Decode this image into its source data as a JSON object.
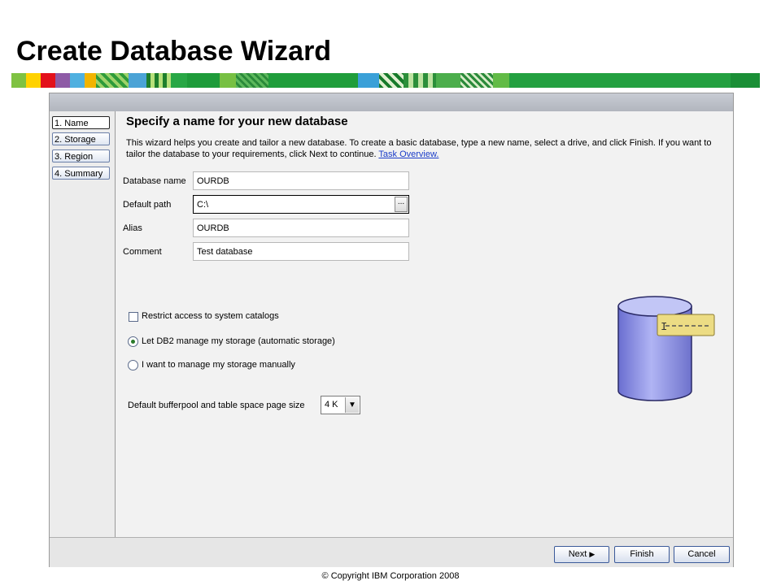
{
  "slide": {
    "title": "Create Database Wizard",
    "copyright": "© Copyright IBM Corporation 2008"
  },
  "nav": {
    "items": [
      {
        "label": "1. Name"
      },
      {
        "label": "2. Storage"
      },
      {
        "label": "3. Region"
      },
      {
        "label": "4. Summary"
      }
    ]
  },
  "main": {
    "heading": "Specify a name for your new database",
    "description": "This wizard helps you create and tailor a new database. To create a basic database, type a new name, select a drive, and click Finish. If you want to tailor the database to your requirements, click Next to continue.",
    "description_link": "Task Overview.",
    "fields": {
      "database_name": {
        "label": "Database name",
        "value": "OURDB"
      },
      "default_path": {
        "label": "Default path",
        "value": "C:\\",
        "browse_label": "..."
      },
      "alias": {
        "label": "Alias",
        "value": "OURDB"
      },
      "comment": {
        "label": "Comment",
        "value": "Test database"
      }
    },
    "restrict_access": {
      "label": "Restrict access to system catalogs",
      "checked": false
    },
    "storage_options": {
      "automatic": {
        "label": "Let DB2 manage my storage (automatic storage)",
        "selected": true
      },
      "manual": {
        "label": "I want to manage my storage manually",
        "selected": false
      }
    },
    "page_size": {
      "label": "Default bufferpool and table space page size",
      "value": "4 K"
    }
  },
  "buttons": {
    "next": "Next",
    "finish": "Finish",
    "cancel": "Cancel"
  },
  "colors": {
    "link": "#1a3cc8",
    "db_cylinder": "#8a8ee0",
    "db_tag": "#e8d77a"
  }
}
